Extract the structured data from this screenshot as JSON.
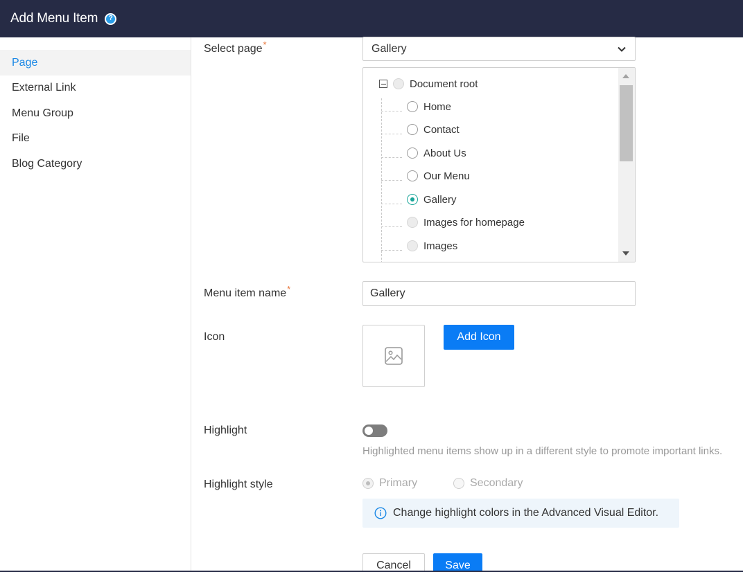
{
  "header": {
    "title": "Add Menu Item",
    "help_icon": "question-circle-icon"
  },
  "sidebar": {
    "items": [
      {
        "label": "Page",
        "active": true
      },
      {
        "label": "External Link",
        "active": false
      },
      {
        "label": "Menu Group",
        "active": false
      },
      {
        "label": "File",
        "active": false
      },
      {
        "label": "Blog Category",
        "active": false
      }
    ]
  },
  "form": {
    "select_page": {
      "label": "Select page",
      "required_marker": "*",
      "value": "Gallery",
      "tree": {
        "root": {
          "label": "Document root",
          "disabled": true
        },
        "items": [
          {
            "label": "Home",
            "checked": false,
            "disabled": false
          },
          {
            "label": "Contact",
            "checked": false,
            "disabled": false
          },
          {
            "label": "About Us",
            "checked": false,
            "disabled": false
          },
          {
            "label": "Our Menu",
            "checked": false,
            "disabled": false
          },
          {
            "label": "Gallery",
            "checked": true,
            "disabled": false
          },
          {
            "label": "Images for homepage",
            "checked": false,
            "disabled": true
          },
          {
            "label": "Images",
            "checked": false,
            "disabled": true
          }
        ]
      }
    },
    "menu_item_name": {
      "label": "Menu item name",
      "required_marker": "*",
      "value": "Gallery"
    },
    "icon": {
      "label": "Icon",
      "placeholder_icon": "image-placeholder-icon",
      "add_button": "Add Icon"
    },
    "highlight": {
      "label": "Highlight",
      "enabled": false,
      "help_text": "Highlighted menu items show up in a different style to promote important links."
    },
    "highlight_style": {
      "label": "Highlight style",
      "options": [
        {
          "label": "Primary",
          "selected": true,
          "disabled": true
        },
        {
          "label": "Secondary",
          "selected": false,
          "disabled": true
        }
      ],
      "info_text": "Change highlight colors in the Advanced Visual Editor."
    }
  },
  "footer": {
    "cancel_label": "Cancel",
    "save_label": "Save"
  },
  "colors": {
    "header_bg": "#262b45",
    "primary": "#0a7cf5",
    "active_link": "#1a88e6",
    "radio_checked": "#1ba69a",
    "required": "#e8763a"
  }
}
